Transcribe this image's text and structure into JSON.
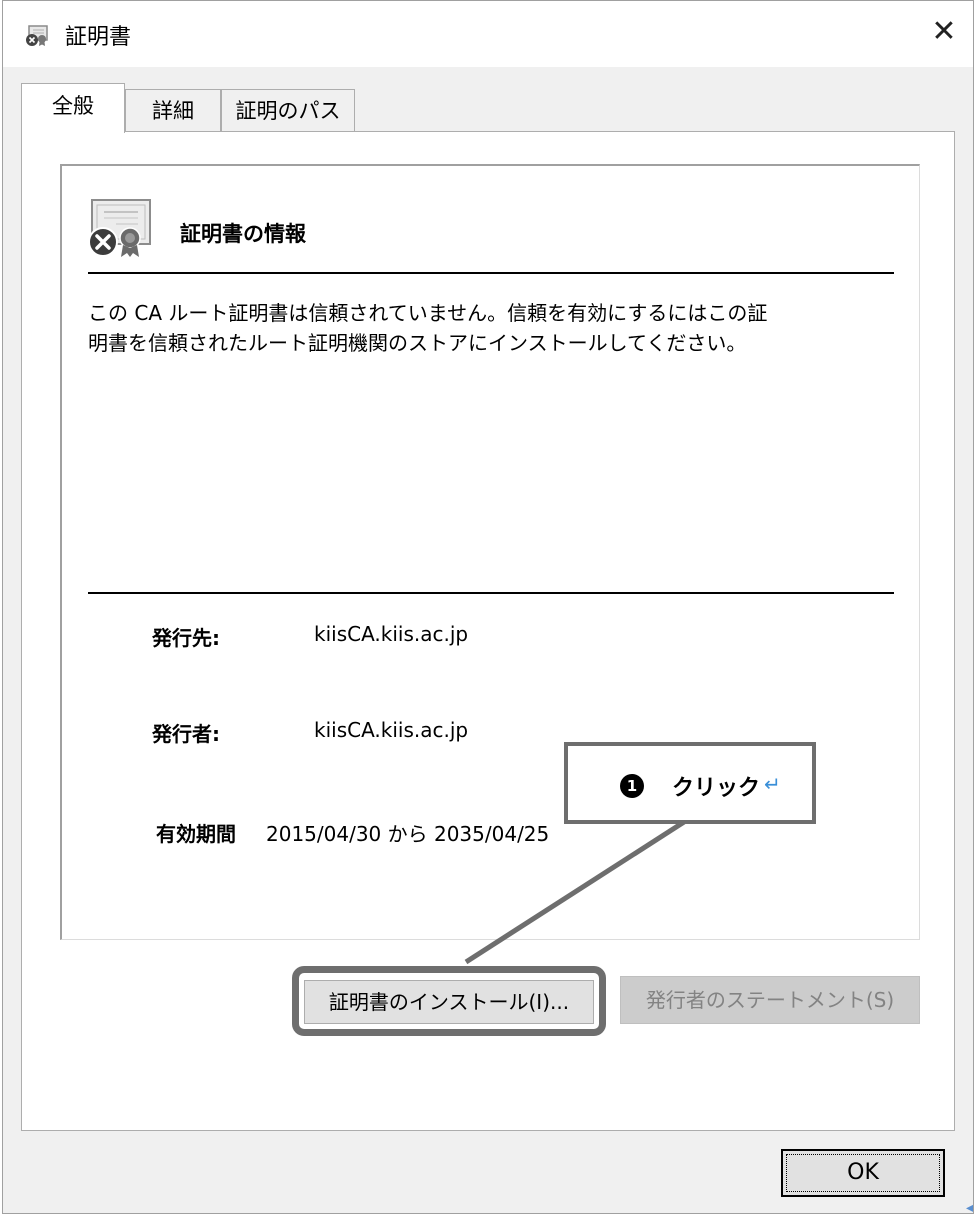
{
  "window": {
    "title": "証明書",
    "close_symbol": "✕"
  },
  "tabs": [
    {
      "label": "全般",
      "active": true
    },
    {
      "label": "詳細",
      "active": false
    },
    {
      "label": "証明のパス",
      "active": false
    }
  ],
  "general": {
    "info_title": "証明書の情報",
    "info_message": "この CA ルート証明書は信頼されていません。信頼を有効にするにはこの証\n明書を信頼されたルート証明機関のストアにインストールしてください。",
    "issued_to_label": "発行先:",
    "issued_to_value": "kiisCA.kiis.ac.jp",
    "issued_by_label": "発行者:",
    "issued_by_value": "kiisCA.kiis.ac.jp",
    "validity_label": "有効期間",
    "validity_text": "2015/04/30  から  2035/04/25"
  },
  "buttons": {
    "install": "証明書のインストール(I)...",
    "statement": "発行者のステートメント(S)",
    "ok": "OK"
  },
  "callout": {
    "number": "1",
    "text": "クリック",
    "return_mark": "↵"
  },
  "icons": {
    "title_icon": "certificate-error-icon",
    "info_icon": "certificate-error-icon"
  },
  "colors": {
    "dialog_bg": "#f0f0f0",
    "callout_border": "#6e6e6e",
    "disabled_text": "#838383"
  }
}
